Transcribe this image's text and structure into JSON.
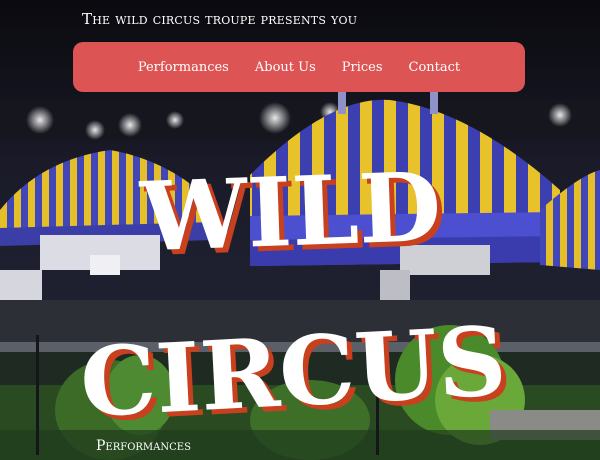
{
  "header": {
    "tagline": "The wild circus troupe presents you"
  },
  "nav": {
    "items": [
      {
        "label": "Performances"
      },
      {
        "label": "About Us"
      },
      {
        "label": "Prices"
      },
      {
        "label": "Contact"
      }
    ]
  },
  "hero": {
    "title_line1": "WILD",
    "title_line2": "CIRCUS"
  },
  "section": {
    "heading": "Performances"
  },
  "colors": {
    "nav_background": "#dd5454",
    "title_text": "#ffffff",
    "title_shadow": "#c8401e",
    "tent_yellow": "#e8c22a",
    "tent_blue": "#3b3fb0"
  }
}
